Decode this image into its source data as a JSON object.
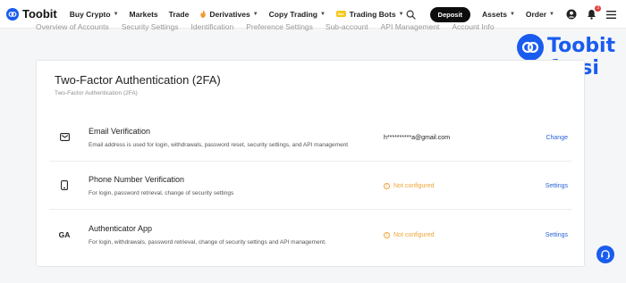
{
  "brand": {
    "name": "Toobit"
  },
  "nav": {
    "items": [
      {
        "label": "Buy Crypto",
        "dropdown": true
      },
      {
        "label": "Markets",
        "dropdown": false
      },
      {
        "label": "Trade",
        "dropdown": false
      },
      {
        "label": "Derivatives",
        "dropdown": true
      },
      {
        "label": "Copy Trading",
        "dropdown": true
      },
      {
        "label": "Trading Bots",
        "dropdown": true
      }
    ],
    "trading_bots_badge": "Bot",
    "deposit_label": "Deposit",
    "assets_label": "Assets",
    "order_label": "Order",
    "notification_count": "3"
  },
  "subtabs": [
    "Overview of Accounts",
    "Security Settings",
    "Identification",
    "Preference Settings",
    "Sub-account",
    "API Management",
    "Account Info"
  ],
  "watermark": {
    "line1": "Toobit",
    "line2": "farsi"
  },
  "card": {
    "title": "Two-Factor Authentication (2FA)",
    "subtitle": "Two-Factor Authentication (2FA)",
    "rows": [
      {
        "icon": "email-icon",
        "title": "Email Verification",
        "description": "Email address is used for login, withdrawals, password reset, security settings, and API management",
        "status": "h**********a@gmail.com",
        "status_type": "value",
        "action": "Change"
      },
      {
        "icon": "phone-icon",
        "title": "Phone Number Verification",
        "description": "For login, password retrieval, change of security settings",
        "status": "Not configured",
        "status_type": "warning",
        "action": "Settings"
      },
      {
        "icon": "GA",
        "title": "Authenticator App",
        "description": "For login, withdrawals, password retrieval, change of security settings and API management.",
        "status": "Not configured",
        "status_type": "warning",
        "action": "Settings"
      }
    ]
  },
  "colors": {
    "accent": "#1a5cf0",
    "warning": "#f0a43a",
    "link": "#2a62d8"
  }
}
